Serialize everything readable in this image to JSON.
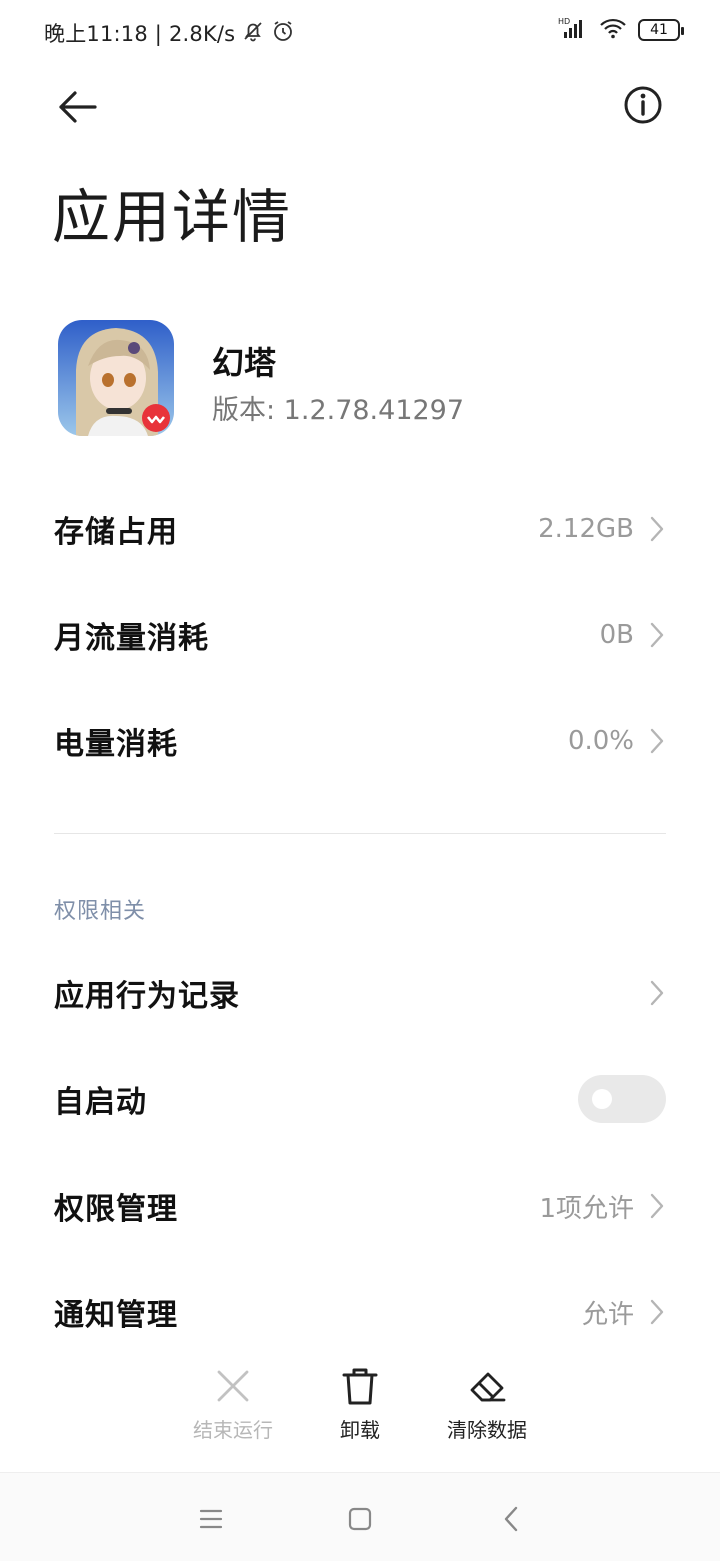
{
  "status_bar": {
    "time_speed": "晚上11:18 | 2.8K/s",
    "battery": "41",
    "network_label": "HD"
  },
  "header": {
    "title": "应用详情"
  },
  "app": {
    "name": "幻塔",
    "version": "版本: 1.2.78.41297"
  },
  "usage": [
    {
      "label": "存储占用",
      "value": "2.12GB"
    },
    {
      "label": "月流量消耗",
      "value": "0B"
    },
    {
      "label": "电量消耗",
      "value": "0.0%"
    }
  ],
  "permissions": {
    "section_title": "权限相关",
    "behavior_record": "应用行为记录",
    "autostart_label": "自启动",
    "autostart_enabled": false,
    "permission_management": {
      "label": "权限管理",
      "value": "1项允许"
    },
    "notification_management": {
      "label": "通知管理",
      "value": "允许"
    }
  },
  "actions": {
    "force_stop": "结束运行",
    "uninstall": "卸载",
    "clear_data": "清除数据"
  },
  "colors": {
    "section_title": "#7f8fa9",
    "value_text": "#9a9a9a",
    "disabled_text": "#b7b7b7"
  }
}
